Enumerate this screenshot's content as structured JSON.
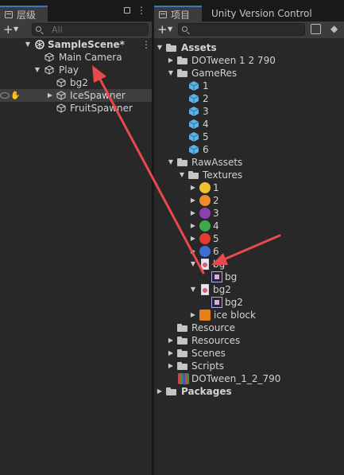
{
  "hierarchy": {
    "tab_label": "层级",
    "search_placeholder": "All",
    "scene": "SampleScene*",
    "nodes": [
      "Main Camera",
      "Play",
      "bg2",
      "IceSpawner",
      "FruitSpawner"
    ]
  },
  "project": {
    "tab_label": "项目",
    "tab2_label": "Unity Version Control",
    "tree": {
      "assets": "Assets",
      "dotween": "DOTween 1 2 790",
      "gameres": "GameRes",
      "gameres_items": [
        "1",
        "2",
        "3",
        "4",
        "5",
        "6"
      ],
      "rawassets": "RawAssets",
      "textures": "Textures",
      "texture_items": [
        "1",
        "2",
        "3",
        "4",
        "5",
        "6"
      ],
      "bg": "bg",
      "bg_child": "bg",
      "bg2": "bg2",
      "bg2_child": "bg2",
      "ice": "ice block",
      "resource": "Resource",
      "resources": "Resources",
      "scenes": "Scenes",
      "scripts": "Scripts",
      "dotween_pkg": "DOTween_1_2_790",
      "packages": "Packages"
    }
  },
  "colors": {
    "annotation_arrow": "#e8494c",
    "accent": "#3a79bb"
  }
}
